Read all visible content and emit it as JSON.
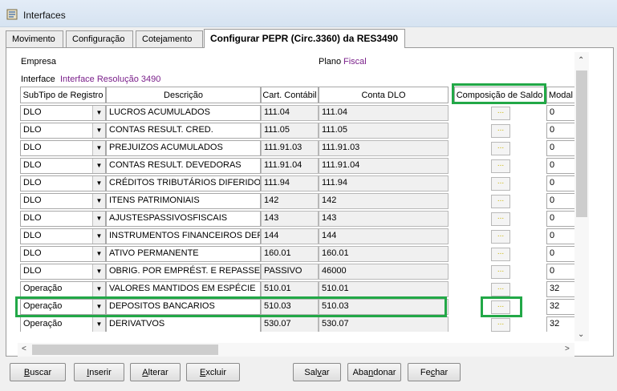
{
  "window": {
    "title": "Interfaces"
  },
  "tabs": [
    "Movimento",
    "Configuração",
    "Cotejamento",
    "Configurar PEPR (Circ.3360) da RES3490"
  ],
  "form": {
    "empresa_label": "Empresa",
    "plano_label": "Plano",
    "plano_value": "Fiscal",
    "interface_label": "Interface",
    "interface_value": "Interface Resolução 3490"
  },
  "grid": {
    "columns": [
      "SubTipo de Registro",
      "Descrição",
      "Cart. Contábil",
      "Conta DLO",
      "Composição de Saldo",
      "Modal"
    ],
    "ellipsis": "...",
    "rows": [
      {
        "subtipo": "DLO",
        "descricao": "LUCROS ACUMULADOS",
        "cart": "111.04",
        "conta": "111.04",
        "modal": "0"
      },
      {
        "subtipo": "DLO",
        "descricao": "CONTAS RESULT. CRED.",
        "cart": "111.05",
        "conta": "111.05",
        "modal": "0"
      },
      {
        "subtipo": "DLO",
        "descricao": "PREJUIZOS ACUMULADOS",
        "cart": "111.91.03",
        "conta": "111.91.03",
        "modal": "0"
      },
      {
        "subtipo": "DLO",
        "descricao": "CONTAS RESULT. DEVEDORAS",
        "cart": "111.91.04",
        "conta": "111.91.04",
        "modal": "0"
      },
      {
        "subtipo": "DLO",
        "descricao": "CRÉDITOS TRIBUTÁRIOS DIFERIDOS",
        "cart": "111.94",
        "conta": "111.94",
        "modal": "0"
      },
      {
        "subtipo": "DLO",
        "descricao": "ITENS PATRIMONIAIS",
        "cart": "142",
        "conta": "142",
        "modal": "0"
      },
      {
        "subtipo": "DLO",
        "descricao": "AJUSTESPASSIVOSFISCAIS",
        "cart": "143",
        "conta": "143",
        "modal": "0"
      },
      {
        "subtipo": "DLO",
        "descricao": "INSTRUMENTOS FINANCEIROS DERIVATIVOS",
        "cart": "144",
        "conta": "144",
        "modal": "0"
      },
      {
        "subtipo": "DLO",
        "descricao": "ATIVO PERMANENTE",
        "cart": "160.01",
        "conta": "160.01",
        "modal": "0"
      },
      {
        "subtipo": "DLO",
        "descricao": "OBRIG. POR EMPRÉST. E REPASSES",
        "cart": "PASSIVO",
        "conta": "46000",
        "modal": "0"
      },
      {
        "subtipo": "Operação",
        "descricao": "VALORES MANTIDOS EM ESPÉCIE",
        "cart": "510.01",
        "conta": "510.01",
        "modal": "32"
      },
      {
        "subtipo": "Operação",
        "descricao": "DEPOSITOS BANCARIOS",
        "cart": "510.03",
        "conta": "510.03",
        "modal": "32"
      },
      {
        "subtipo": "Operação",
        "descricao": "DERIVATVOS",
        "cart": "530.07",
        "conta": "530.07",
        "modal": "32"
      }
    ]
  },
  "buttons": [
    {
      "pre": "",
      "u": "B",
      "post": "uscar"
    },
    {
      "pre": "",
      "u": "I",
      "post": "nserir"
    },
    {
      "pre": "",
      "u": "A",
      "post": "lterar"
    },
    {
      "pre": "",
      "u": "E",
      "post": "xcluir"
    },
    {
      "pre": "Sal",
      "u": "v",
      "post": "ar"
    },
    {
      "pre": "Aba",
      "u": "n",
      "post": "donar"
    },
    {
      "pre": "Fe",
      "u": "c",
      "post": "har"
    }
  ],
  "colors": {
    "highlight": "#22a847",
    "value_text": "#7a1f8a",
    "ellipsis": "#c8b300"
  }
}
